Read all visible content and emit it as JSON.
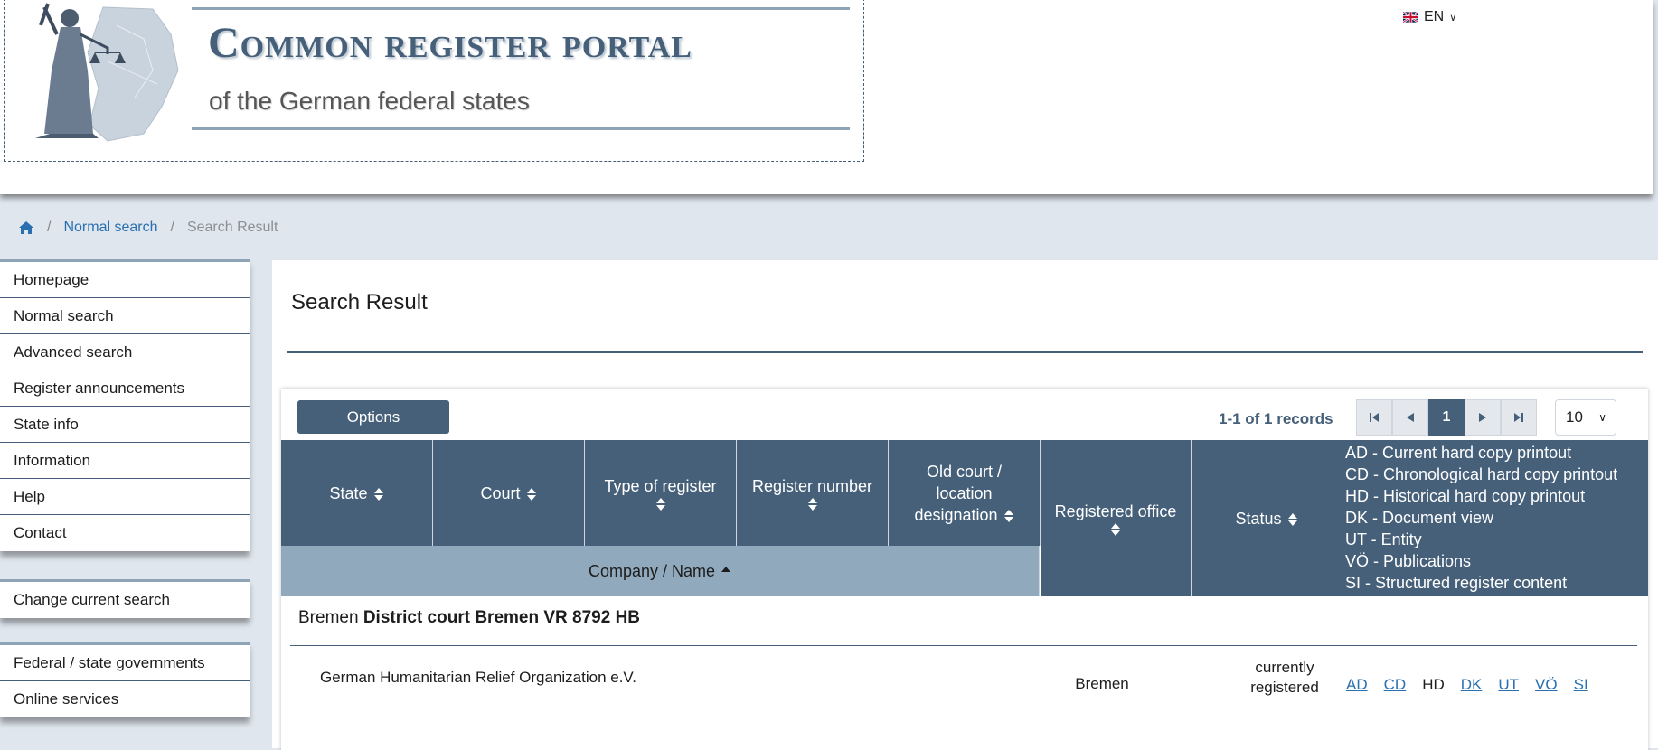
{
  "header": {
    "title": "Common register portal",
    "subtitle": "of the German federal states",
    "language": "EN"
  },
  "breadcrumb": {
    "items": [
      {
        "label": "Normal search"
      },
      {
        "label": "Search Result"
      }
    ]
  },
  "sidebar": {
    "main_menu": [
      {
        "label": "Homepage"
      },
      {
        "label": "Normal search"
      },
      {
        "label": "Advanced search"
      },
      {
        "label": "Register announcements"
      },
      {
        "label": "State info"
      },
      {
        "label": "Information"
      },
      {
        "label": "Help"
      },
      {
        "label": "Contact"
      }
    ],
    "search_menu": [
      {
        "label": "Change current search"
      }
    ],
    "extra_menu": [
      {
        "label": "Federal / state governments"
      },
      {
        "label": "Online services"
      }
    ]
  },
  "main": {
    "title": "Search Result",
    "options_label": "Options",
    "records_text": "1-1 of 1 records",
    "current_page": "1",
    "per_page": "10",
    "columns": {
      "state": "State",
      "court": "Court",
      "type_of_register": "Type of register",
      "register_number": "Register number",
      "old_court": "Old court / location designation",
      "registered_office": "Registered office",
      "status": "Status",
      "company_name": "Company / Name"
    },
    "legend": [
      "AD - Current hard copy printout",
      "CD - Chronological hard copy printout",
      "HD - Historical hard copy printout",
      "DK - Document view",
      "UT - Entity",
      "VÖ - Publications",
      "SI - Structured register content"
    ],
    "results": [
      {
        "state": "Bremen",
        "court_line": "District court Bremen VR 8792 HB",
        "company": "German Humanitarian Relief Organization e.V.",
        "office": "Bremen",
        "status_line1": "currently",
        "status_line2": "registered",
        "links": [
          {
            "label": "AD",
            "link": true
          },
          {
            "label": "CD",
            "link": true
          },
          {
            "label": "HD",
            "link": false
          },
          {
            "label": "DK",
            "link": true
          },
          {
            "label": "UT",
            "link": true
          },
          {
            "label": "VÖ",
            "link": true
          },
          {
            "label": "SI",
            "link": true
          }
        ]
      }
    ]
  },
  "colors": {
    "primary": "#46607a",
    "header_light": "#91a9bd",
    "link": "#2a6fb0",
    "background": "#dfe6ee"
  }
}
